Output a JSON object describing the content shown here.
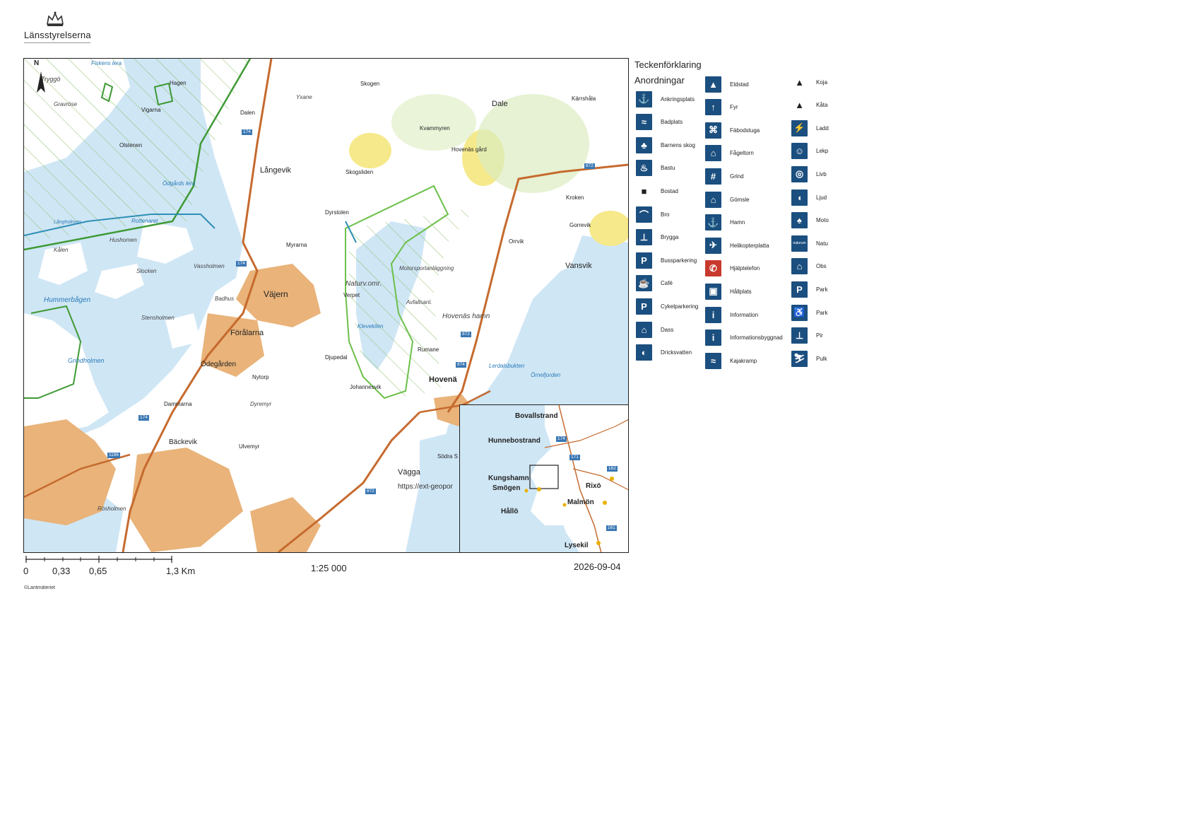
{
  "header": {
    "brand": "Länsstyrelserna"
  },
  "map": {
    "north_label": "N",
    "place_names": {
      "tryggo": "Tryggö",
      "fiskens_lera": "Fiskens lera",
      "hagen": "Hagen",
      "gravrose": "Gravröse",
      "vigarna": "Vigarna",
      "olstenen": "Olstenen",
      "yxane": "Yxane",
      "dalen": "Dalen",
      "skogen": "Skogen",
      "dale": "Dale",
      "karrshala": "Kärrshåla",
      "kvammyren": "Kvammyren",
      "langevik": "Långevik",
      "odgards_lera": "Ödgårds lera",
      "skogsliden": "Skogsliden",
      "hovenas_gard": "Hovenäs gård",
      "kroken": "Kroken",
      "dyrstolen": "Dyrstolen",
      "gorrevik": "Gorrevik",
      "langholmen": "Långholmen",
      "rottenaret": "Rottenaret",
      "hushomen": "Hushomen",
      "myrarna": "Myrarna",
      "orrvik": "Orrvik",
      "kalen": "Kålen",
      "slocken": "Slocken",
      "vassholmen": "Vassholmen",
      "motorsport": "Motorsportanläggning",
      "vansvik": "Vansvik",
      "naturv_omr": "Naturv.omr.",
      "vajern": "Väjern",
      "hummerbagen": "Hummerbågen",
      "badhus": "Badhus",
      "verpet": "Verpet",
      "avfallsanl": "Avfallsanl.",
      "hovenas_hamn": "Hovenäs hamn",
      "stensholmen": "Stensholmen",
      "foralarna": "Förålarna",
      "klevekilen": "Klevekilen",
      "rumane": "Rumane",
      "grindholmen": "Grindholmen",
      "odegarden": "Ödegården",
      "djupedal": "Djupedal",
      "lerdalsbukten": "Lerdalsbukten",
      "ornefjorden": "Örnefjorden",
      "nytorp": "Nytorp",
      "johannesvik": "Johannesvik",
      "hovenas": "Hovenä",
      "dammarna": "Dammarna",
      "dyremyr": "Dyremyr",
      "backevik": "Bäckevik",
      "ulvemyr": "Ulvemyr",
      "sodra": "Södra S",
      "vagga": "Vägga",
      "rosholmen": "Rösholmen",
      "url_fragment": "https://ext-geopor"
    },
    "road_badges": {
      "r174_a": "174",
      "r174_b": "174",
      "r174_c": "174",
      "r872_a": "872",
      "r872_b": "872",
      "r872_c": "872",
      "r874": "874",
      "r1186": "1186"
    },
    "colors": {
      "water": "#cfe6f5",
      "land": "#ffffff",
      "urban": "#e9b37a",
      "road": "#c66a2e",
      "reserve_green": "#4aa63a",
      "boundary_blue": "#2f8fb5"
    }
  },
  "inset": {
    "labels": {
      "bovallstrand": "Bovallstrand",
      "hunnebostrand": "Hunnebostrand",
      "kungshamn": "Kungshamn",
      "smogen": "Smögen",
      "rixo": "Rixö",
      "malmon": "Malmön",
      "hallo": "Hållö",
      "lysekil": "Lysekil"
    },
    "road_badges": {
      "r174": "174",
      "r171": "171",
      "r162": "162",
      "r161": "161"
    }
  },
  "scale": {
    "ticks": [
      "0",
      "0,33",
      "0,65",
      "1,3 Km"
    ],
    "ratio": "1:25 000",
    "date": "2026-09-04"
  },
  "copyright": "©Lantmäteriet",
  "legend": {
    "title": "Teckenförklaring",
    "subtitle": "Anordningar",
    "col1": [
      {
        "label": "Ankringsplats",
        "icon": "anchor-icon",
        "glyph": "⚓"
      },
      {
        "label": "Badplats",
        "icon": "swimmer-icon",
        "glyph": "≈"
      },
      {
        "label": "Barnens skog",
        "icon": "children-forest-icon",
        "glyph": "♣"
      },
      {
        "label": "Bastu",
        "icon": "sauna-icon",
        "glyph": "♨"
      },
      {
        "label": "Bostad",
        "icon": "square-icon",
        "glyph": "■"
      },
      {
        "label": "Bro",
        "icon": "bridge-icon",
        "glyph": "⌒"
      },
      {
        "label": "Brygga",
        "icon": "jetty-icon",
        "glyph": "⊥"
      },
      {
        "label": "Bussparkering",
        "icon": "bus-parking-icon",
        "glyph": "P"
      },
      {
        "label": "Café",
        "icon": "cafe-icon",
        "glyph": "☕"
      },
      {
        "label": "Cykelparkering",
        "icon": "bike-parking-icon",
        "glyph": "P"
      },
      {
        "label": "Dass",
        "icon": "toilet-icon",
        "glyph": "⌂"
      },
      {
        "label": "Dricksvatten",
        "icon": "drinking-water-icon",
        "glyph": "◐"
      }
    ],
    "col2": [
      {
        "label": "Eldstad",
        "icon": "fireplace-icon",
        "glyph": "▲"
      },
      {
        "label": "Fyr",
        "icon": "lighthouse-icon",
        "glyph": "↑"
      },
      {
        "label": "Fäbodstuga",
        "icon": "cottage-icon",
        "glyph": "⌘"
      },
      {
        "label": "Fågeltorn",
        "icon": "bird-tower-icon",
        "glyph": "⌂"
      },
      {
        "label": "Grind",
        "icon": "gate-icon",
        "glyph": "#"
      },
      {
        "label": "Gömsle",
        "icon": "hide-icon",
        "glyph": "⌂"
      },
      {
        "label": "Hamn",
        "icon": "harbour-icon",
        "glyph": "⚓"
      },
      {
        "label": "Helikopterplatta",
        "icon": "helicopter-icon",
        "glyph": "✈"
      },
      {
        "label": "Hjälptelefon",
        "icon": "sos-phone-icon",
        "glyph": "✆"
      },
      {
        "label": "Hållplats",
        "icon": "bus-stop-icon",
        "glyph": "▣"
      },
      {
        "label": "Information",
        "icon": "information-icon",
        "glyph": "i"
      },
      {
        "label": "Informationsbyggnad",
        "icon": "information-building-icon",
        "glyph": "i"
      },
      {
        "label": "Kajakramp",
        "icon": "kayak-ramp-icon",
        "glyph": "≈"
      }
    ],
    "col3": [
      {
        "label": "Koja",
        "icon": "hut-icon",
        "glyph": "▲"
      },
      {
        "label": "Kåta",
        "icon": "kata-icon",
        "glyph": "▲"
      },
      {
        "label": "Ladd",
        "icon": "charging-icon",
        "glyph": "⚡"
      },
      {
        "label": "Lekp",
        "icon": "playground-icon",
        "glyph": "☺"
      },
      {
        "label": "Livb",
        "icon": "lifebuoy-icon",
        "glyph": "◎"
      },
      {
        "label": "Ljud",
        "icon": "audio-icon",
        "glyph": "◖"
      },
      {
        "label": "Moto",
        "icon": "motion-icon",
        "glyph": "♠"
      },
      {
        "label": "Natu",
        "icon": "naturum-icon",
        "glyph": "naturum"
      },
      {
        "label": "Obs",
        "icon": "observation-icon",
        "glyph": "⌂"
      },
      {
        "label": "Park",
        "icon": "parking-icon",
        "glyph": "P"
      },
      {
        "label": "Park",
        "icon": "disabled-parking-icon",
        "glyph": "♿"
      },
      {
        "label": "Pir",
        "icon": "pier-icon",
        "glyph": "⊥"
      },
      {
        "label": "Pulk",
        "icon": "sled-icon",
        "glyph": "⛷"
      }
    ]
  }
}
